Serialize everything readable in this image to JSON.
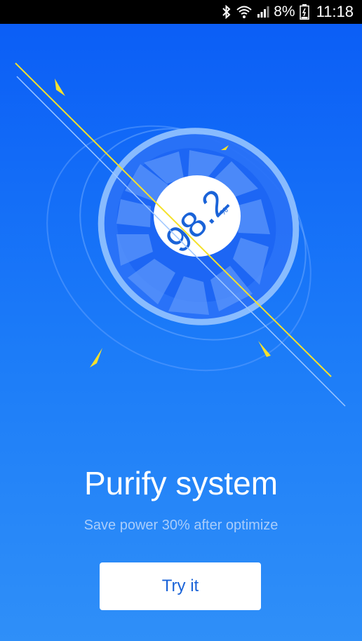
{
  "status_bar": {
    "battery_percent": "8%",
    "time": "11:18",
    "icons": [
      "bluetooth-icon",
      "wifi-icon",
      "signal-icon",
      "battery-icon"
    ]
  },
  "gauge": {
    "value": "98.2",
    "unit": "%"
  },
  "content": {
    "title": "Purify system",
    "subtitle": "Save power 30% after optimize",
    "button_label": "Try it"
  },
  "colors": {
    "background_top": "#0a5cf6",
    "background_bottom": "#2f8ff8",
    "accent_yellow": "#f5e12c",
    "button_text": "#1a63d8"
  }
}
